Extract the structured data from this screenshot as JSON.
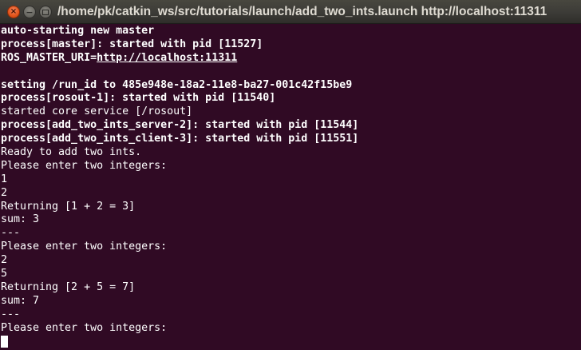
{
  "window": {
    "title": "/home/pk/catkin_ws/src/tutorials/launch/add_two_ints.launch http://localhost:11311",
    "buttons": {
      "close_icon": "×",
      "minimize_icon": "−"
    }
  },
  "colors": {
    "terminal_bg": "#300a24",
    "terminal_fg": "#ffffff",
    "titlebar_bg": "#3c3b37",
    "close_button": "#e2541b"
  },
  "terminal": {
    "lines": [
      {
        "text": "auto-starting new master",
        "bold": false
      },
      {
        "text": "process[master]: started with pid [11527]",
        "bold": true
      },
      {
        "prefix": "ROS_MASTER_URI=",
        "link": "http://localhost:11311",
        "bold": true
      },
      {
        "text": "",
        "bold": false
      },
      {
        "text": "setting /run_id to 485e948e-18a2-11e8-ba27-001c42f15be9",
        "bold": true
      },
      {
        "text": "process[rosout-1]: started with pid [11540]",
        "bold": true
      },
      {
        "text": "started core service [/rosout]",
        "bold": false
      },
      {
        "text": "process[add_two_ints_server-2]: started with pid [11544]",
        "bold": true
      },
      {
        "text": "process[add_two_ints_client-3]: started with pid [11551]",
        "bold": true
      },
      {
        "text": "Ready to add two ints.",
        "bold": false
      },
      {
        "text": "Please enter two integers:",
        "bold": false
      },
      {
        "text": "1",
        "bold": false
      },
      {
        "text": "2",
        "bold": false
      },
      {
        "text": "Returning [1 + 2 = 3]",
        "bold": false
      },
      {
        "text": "sum: 3",
        "bold": false
      },
      {
        "text": "---",
        "bold": false
      },
      {
        "text": "Please enter two integers:",
        "bold": false
      },
      {
        "text": "2",
        "bold": false
      },
      {
        "text": "5",
        "bold": false
      },
      {
        "text": "Returning [2 + 5 = 7]",
        "bold": false
      },
      {
        "text": "sum: 7",
        "bold": false
      },
      {
        "text": "---",
        "bold": false
      },
      {
        "text": "Please enter two integers:",
        "bold": false
      }
    ]
  }
}
